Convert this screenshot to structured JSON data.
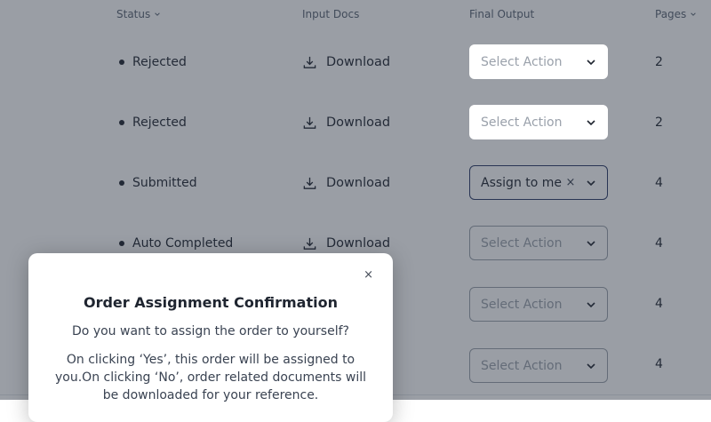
{
  "header": {
    "status": "Status",
    "input_docs": "Input Docs",
    "final_output": "Final Output",
    "pages": "Pages"
  },
  "rows": [
    {
      "status": "Rejected",
      "download": "Download",
      "action": "Select Action",
      "pages": "2"
    },
    {
      "status": "Rejected",
      "download": "Download",
      "action": "Select Action",
      "pages": "2"
    },
    {
      "status": "Submitted",
      "download": "Download",
      "action": "Assign to me",
      "pages": "4"
    },
    {
      "status": "Auto Completed",
      "download": "Download",
      "action": "Select Action",
      "pages": "4"
    },
    {
      "status": "",
      "download": "",
      "action": "Select Action",
      "pages": "4"
    },
    {
      "status": "",
      "download": "",
      "action": "Select Action",
      "pages": "4"
    }
  ],
  "modal": {
    "close": "×",
    "title": "Order Assignment Confirmation",
    "question": "Do you want to assign the order to yourself?",
    "description": "On clicking ‘Yes’, this order will be assigned to you.On clicking ‘No’, order related documents will be downloaded for your reference."
  },
  "colors": {
    "overlay": "#283040",
    "text": "#1f2530",
    "active_border": "#2b3a67",
    "placeholder": "#9aa1ab"
  }
}
